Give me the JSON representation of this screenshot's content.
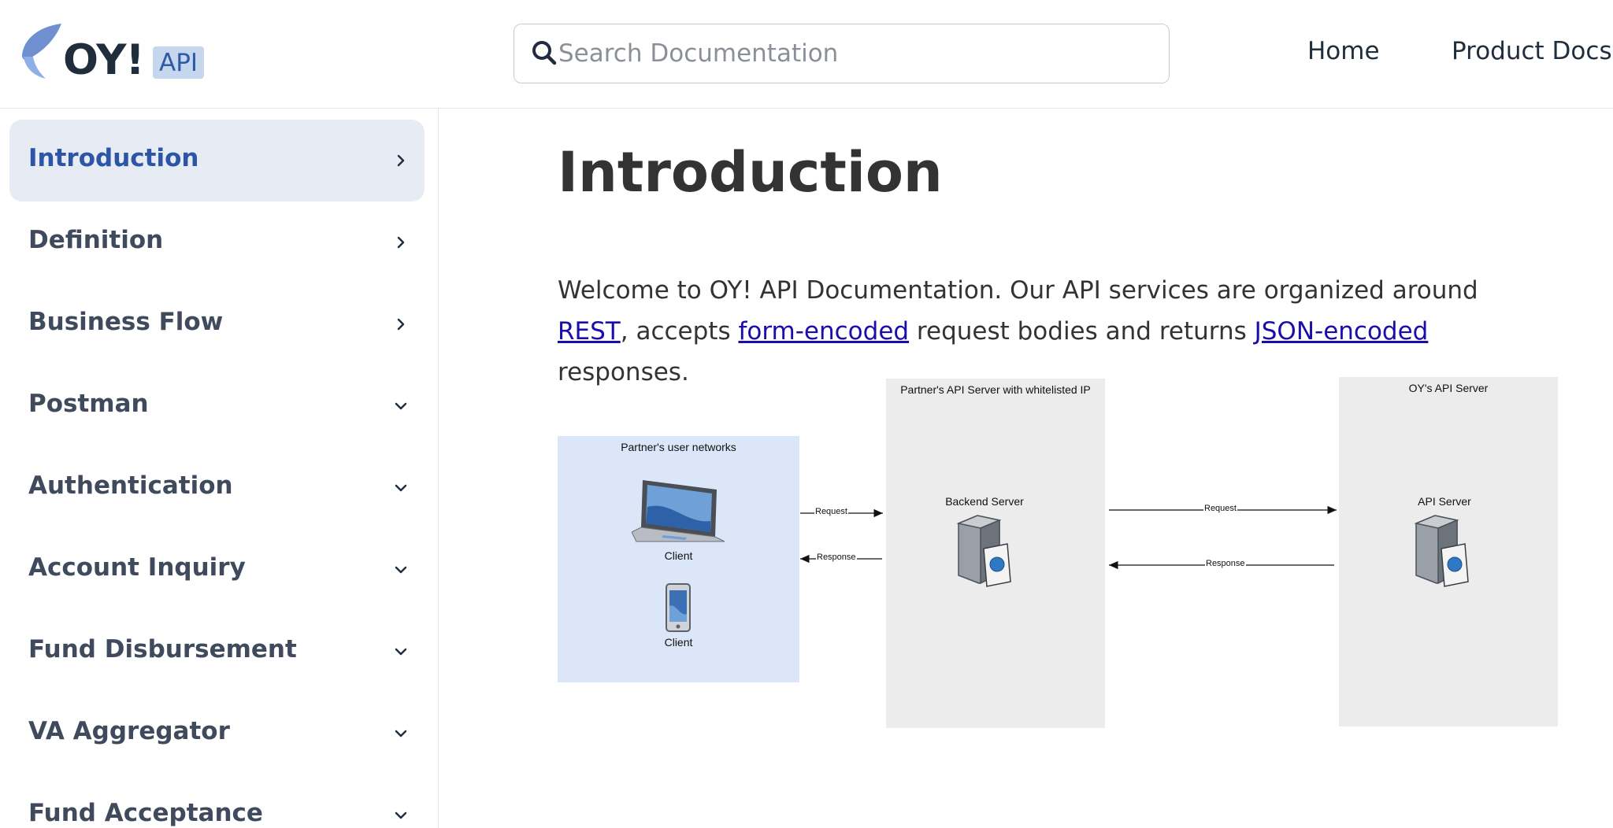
{
  "header": {
    "logo_text": "OY!",
    "logo_badge": "API",
    "search_placeholder": "Search Documentation",
    "nav": [
      {
        "label": "Home"
      },
      {
        "label": "Product Docs"
      }
    ]
  },
  "sidebar": {
    "items": [
      {
        "label": "Introduction",
        "chevron": "chevron-right-icon",
        "active": true
      },
      {
        "label": "Definition",
        "chevron": "chevron-right-icon"
      },
      {
        "label": "Business Flow",
        "chevron": "chevron-right-icon"
      },
      {
        "label": "Postman",
        "chevron": "chevron-down-icon"
      },
      {
        "label": "Authentication",
        "chevron": "chevron-down-icon"
      },
      {
        "label": "Account Inquiry",
        "chevron": "chevron-down-icon"
      },
      {
        "label": "Fund Disbursement",
        "chevron": "chevron-down-icon"
      },
      {
        "label": "VA Aggregator",
        "chevron": "chevron-down-icon"
      },
      {
        "label": "Fund Acceptance",
        "chevron": "chevron-down-icon"
      }
    ]
  },
  "main": {
    "title": "Introduction",
    "intro": {
      "part1": "Welcome to OY! API Documentation. Our API services are organized around ",
      "link_rest": "REST",
      "part2": ", accepts ",
      "link_form": "form-encoded",
      "part3": " request bodies and returns ",
      "link_json": "JSON-encoded",
      "part4": " responses."
    },
    "diagram": {
      "partner_networks": "Partner's user networks",
      "client_laptop": "Client",
      "client_phone": "Client",
      "partner_server_box": "Partner's API Server with whitelisted IP",
      "backend_server": "Backend Server",
      "oy_server_box": "OY's API Server",
      "api_server": "API Server",
      "request_1": "Request",
      "response_1": "Response",
      "request_2": "Request",
      "response_2": "Response"
    }
  },
  "colors": {
    "accent": "#2c55a6",
    "active_bg": "#e6ebf4",
    "link": "#1a0dab",
    "sidebar_text": "#3f4b5c",
    "diagram_client_bg": "#dbe6f8",
    "diagram_server_bg": "#ececec"
  }
}
